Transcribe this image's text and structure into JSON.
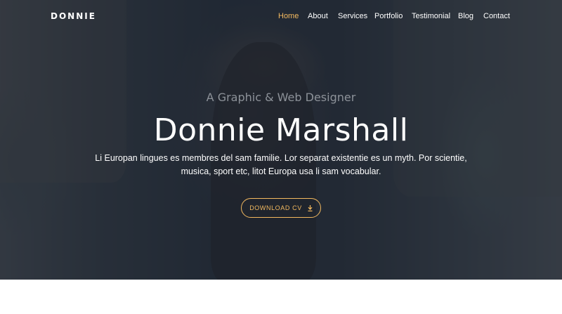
{
  "brand": {
    "name": "DONNIE"
  },
  "nav": {
    "items": [
      {
        "label": "Home",
        "active": true
      },
      {
        "label": "About"
      },
      {
        "label": "Services"
      },
      {
        "label": "Portfolio"
      },
      {
        "label": "Testimonial"
      },
      {
        "label": "Blog"
      },
      {
        "label": "Contact"
      }
    ]
  },
  "hero": {
    "subtitle": "A Graphic & Web Designer",
    "title": "Donnie Marshall",
    "description": "Li Europan lingues es membres del sam familie. Lor separat existentie es un myth. Por scientie, musica, sport etc, litot Europa usa li sam vocabular.",
    "cta_label": "DOWNLOAD CV",
    "cta_icon": "download-icon"
  },
  "colors": {
    "accent": "#f3b95f",
    "overlay": "#181e2a",
    "text": "#ffffff",
    "muted": "#8d9299"
  }
}
